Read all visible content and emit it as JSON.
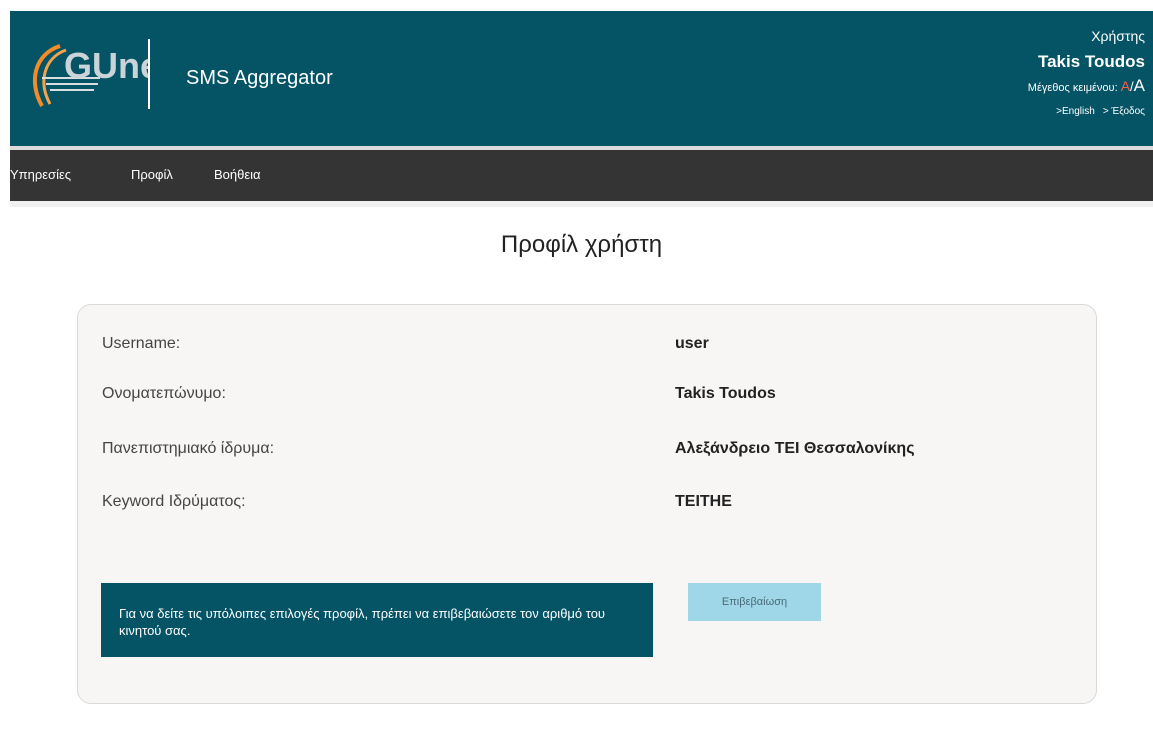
{
  "header": {
    "app_title": "SMS Aggregator",
    "logo_text": "GUnet",
    "user_label": "Χρήστης",
    "user_name": "Takis Toudos",
    "font_size_label": "Μέγεθος κειμένου:",
    "font_small": "A",
    "font_sep": "/",
    "font_large": "A",
    "lang_link": ">English",
    "logout_link": "> Έξοδος"
  },
  "nav": {
    "items": [
      {
        "label": "Υπηρεσίες"
      },
      {
        "label": "Προφίλ"
      },
      {
        "label": "Βοήθεια"
      }
    ]
  },
  "main": {
    "title": "Προφίλ χρήστη",
    "rows": [
      {
        "label": "Username:",
        "value": "user"
      },
      {
        "label": "Ονοματεπώνυμο:",
        "value": "Takis Toudos"
      },
      {
        "label": "Πανεπιστημιακό ίδρυμα:",
        "value": "Αλεξάνδρειο ΤΕΙ Θεσσαλονίκης"
      },
      {
        "label": "Keyword Ιδρύματος:",
        "value": "TEITHE"
      }
    ],
    "notice": "Για να δείτε τις υπόλοιπες επιλογές προφίλ, πρέπει να επιβεβαιώσετε τον αριθμό του κινητού σας.",
    "confirm_label": "Επιβεβαίωση"
  },
  "colors": {
    "header_bg": "#045466",
    "nav_bg": "#343434",
    "card_bg": "#f7f6f5",
    "button_bg": "#9fd6e8",
    "accent_red": "#ff5a4a"
  }
}
